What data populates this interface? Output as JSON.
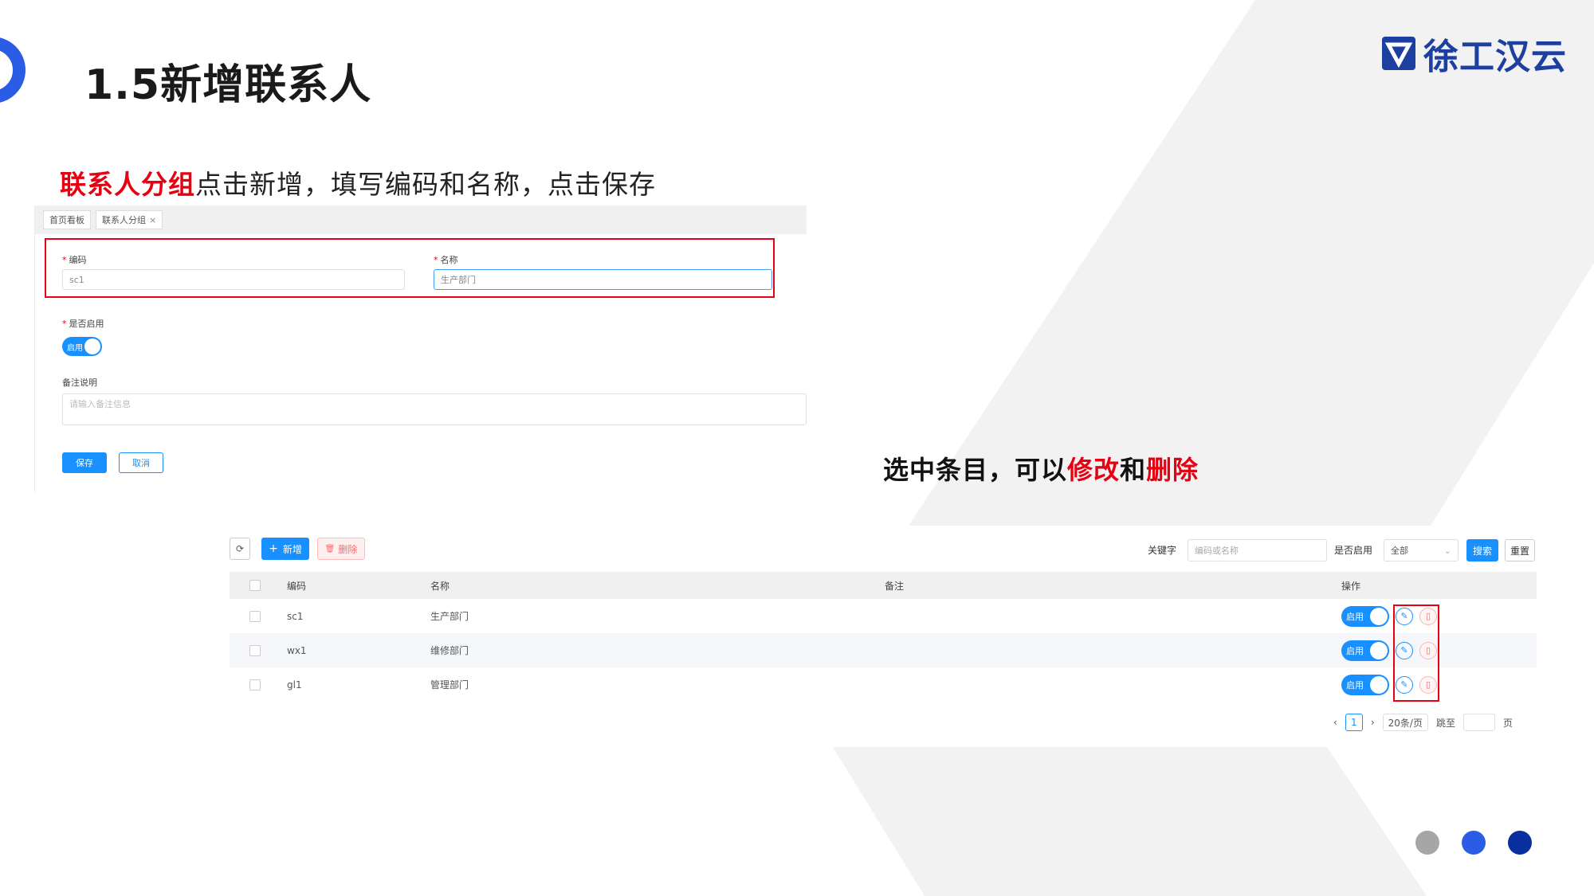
{
  "slide": {
    "title": "1.5新增联系人",
    "brand_name": "徐工汉云"
  },
  "instructions": {
    "line1_highlight": "联系人分组",
    "line1_rest": "点击新增，填写编码和名称，点击保存",
    "line2_a": "选中条目，可以",
    "line2_edit": "修改",
    "line2_b": "和",
    "line2_delete": "删除"
  },
  "form": {
    "tabs": [
      {
        "label": "首页看板"
      },
      {
        "label": "联系人分组",
        "close": "×"
      }
    ],
    "required_mark": "*",
    "code_label": "编码",
    "code_value": "sc1",
    "name_label": "名称",
    "name_value": "生产部门",
    "enabled_label": "是否启用",
    "enabled_switch": "启用",
    "remark_label": "备注说明",
    "remark_placeholder": "请输入备注信息",
    "save_button": "保存",
    "cancel_button": "取消"
  },
  "table": {
    "toolbar": {
      "refresh_icon": "⟳",
      "add_icon": "+",
      "add_label": "新增",
      "delete_icon": "🗑",
      "delete_label": "删除",
      "keyword_label": "关键字",
      "keyword_placeholder": "编码或名称",
      "enabled_label": "是否启用",
      "enabled_value": "全部",
      "search_button": "搜索",
      "reset_button": "重置"
    },
    "columns": [
      "编码",
      "名称",
      "备注",
      "操作"
    ],
    "rows": [
      {
        "code": "sc1",
        "name": "生产部门",
        "remark": "",
        "status": "启用"
      },
      {
        "code": "wx1",
        "name": "维修部门",
        "remark": "",
        "status": "启用"
      },
      {
        "code": "gl1",
        "name": "管理部门",
        "remark": "",
        "status": "启用"
      }
    ],
    "pagination": {
      "prev": "‹",
      "current": "1",
      "next": "›",
      "page_size": "20条/页",
      "jump_label": "跳至",
      "page_suffix": "页"
    }
  },
  "colors": {
    "accent_red": "#e60012",
    "primary_blue": "#1890ff",
    "brand_blue": "#1d3fa0",
    "dot_gray": "#a6a6a6",
    "dot_blue": "#2b5ce6",
    "dot_navy": "#0a2f9e"
  }
}
